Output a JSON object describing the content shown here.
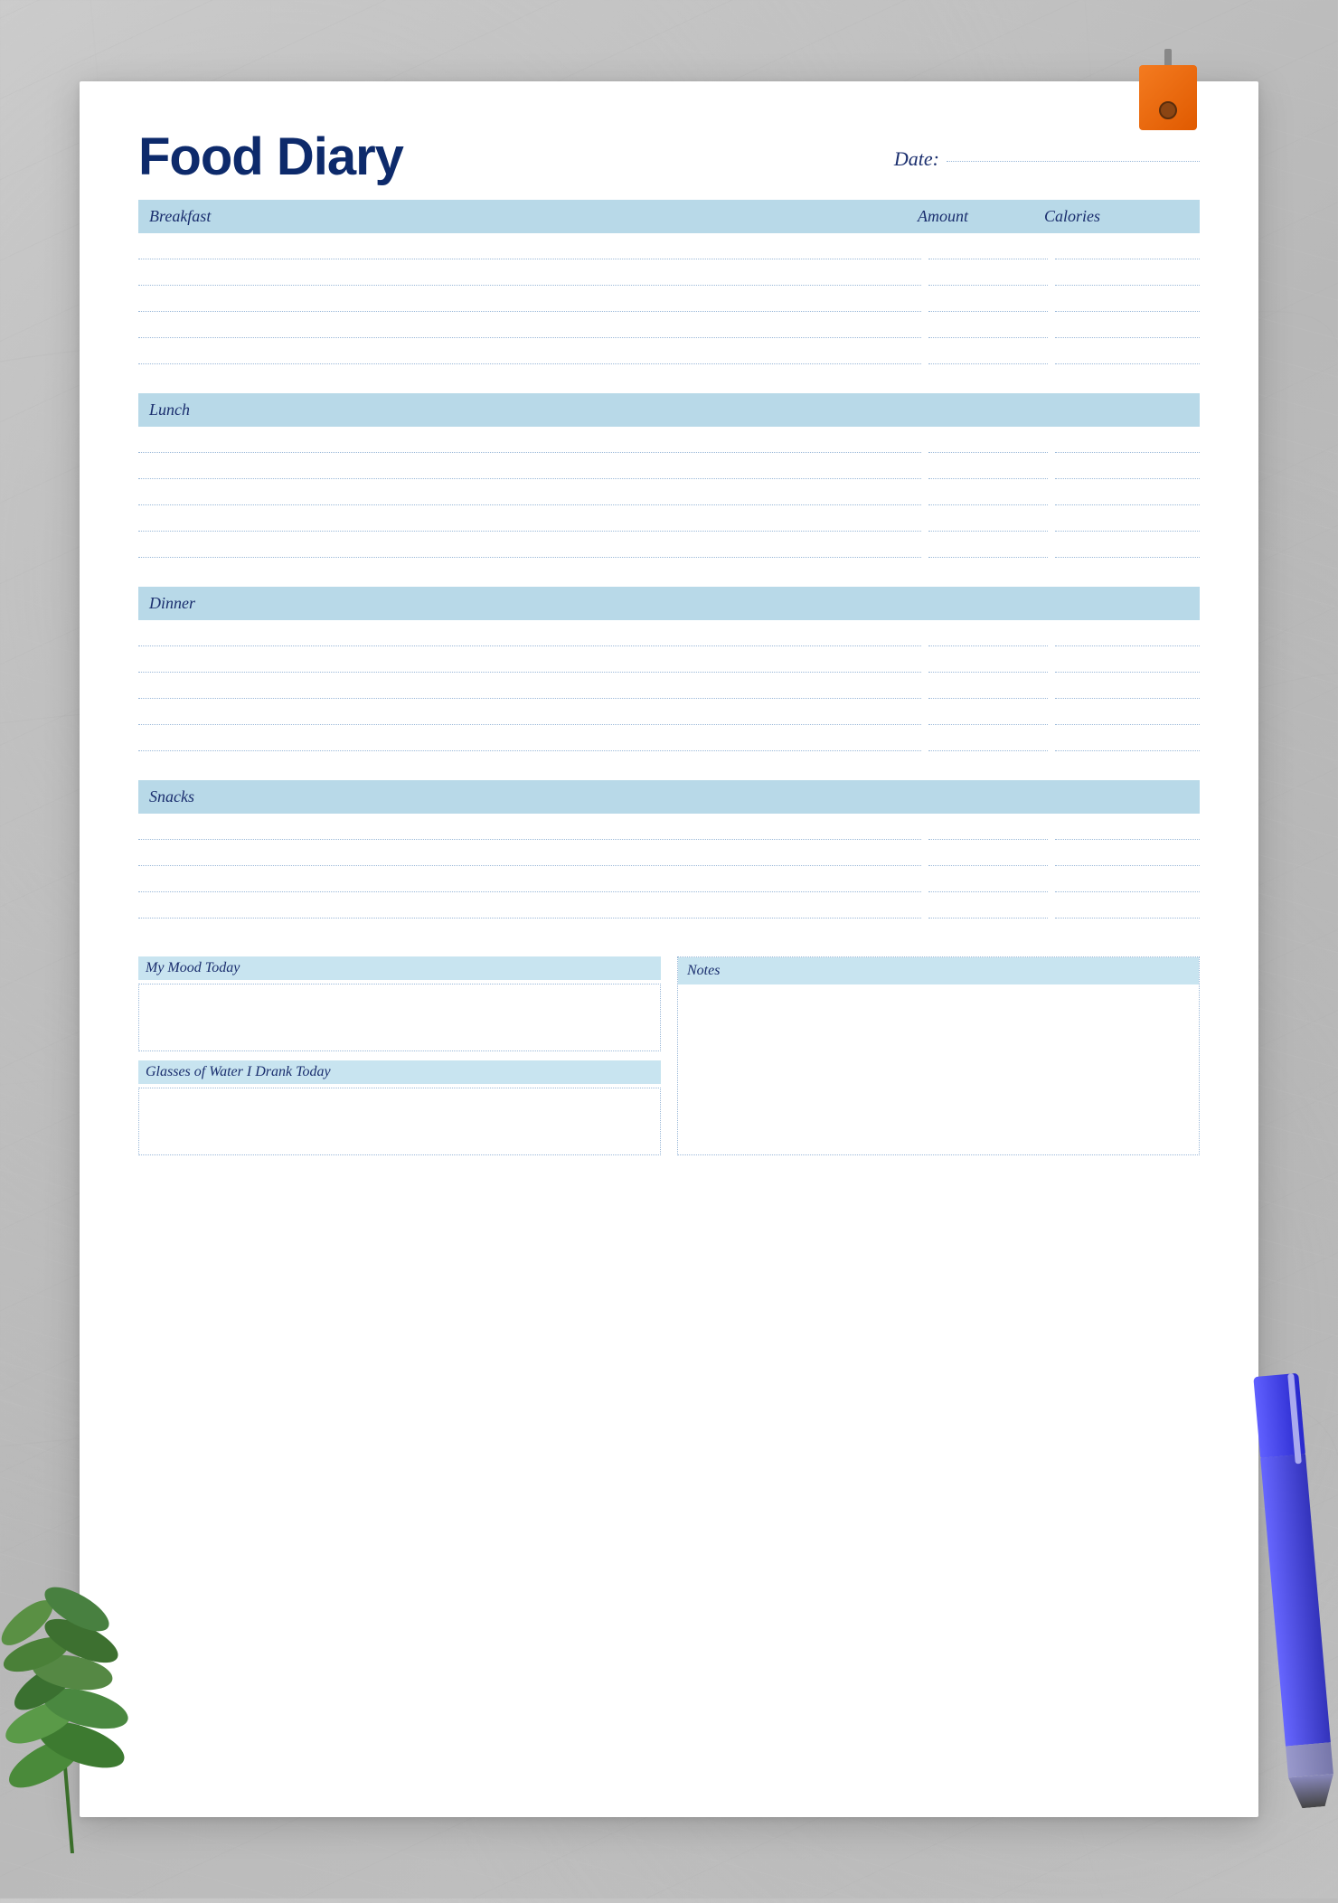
{
  "page": {
    "title": "Food Diary",
    "date_label": "Date:",
    "sections": [
      {
        "id": "breakfast",
        "label": "Breakfast",
        "col_amount": "Amount",
        "col_calories": "Calories",
        "rows": 5
      },
      {
        "id": "lunch",
        "label": "Lunch",
        "rows": 5
      },
      {
        "id": "dinner",
        "label": "Dinner",
        "rows": 5
      },
      {
        "id": "snacks",
        "label": "Snacks",
        "rows": 4
      }
    ],
    "bottom": {
      "mood_label": "My Mood Today",
      "water_label": "Glasses of Water I Drank Today",
      "notes_label": "Notes"
    }
  }
}
